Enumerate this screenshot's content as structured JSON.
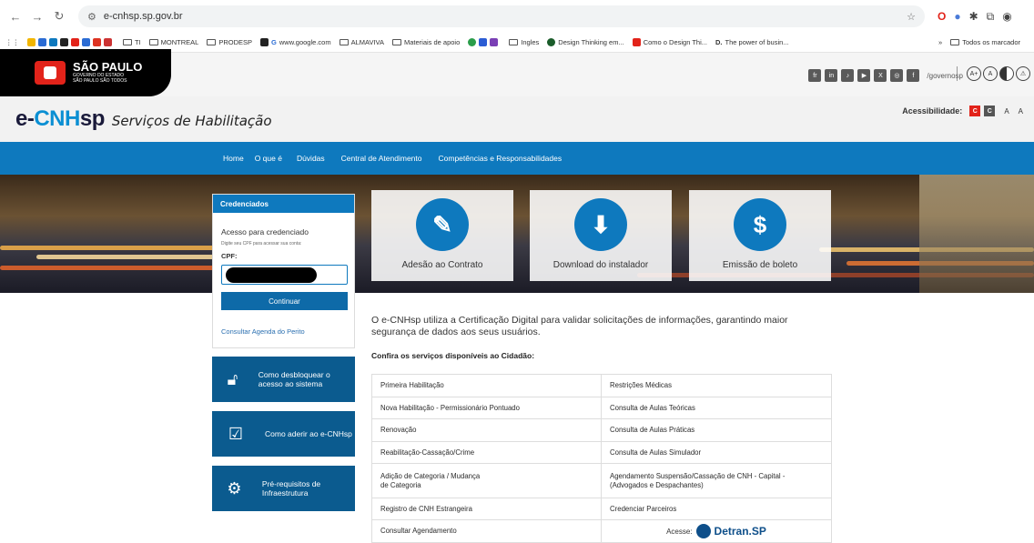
{
  "browser": {
    "url": "e-cnhsp.sp.gov.br",
    "bookmarks": [
      {
        "label": "TI",
        "type": "folder"
      },
      {
        "label": "MONTREAL",
        "type": "folder"
      },
      {
        "label": "PRODESP",
        "type": "folder"
      },
      {
        "label": "www.google.com",
        "type": "site"
      },
      {
        "label": "ALMAVIVA",
        "type": "folder"
      },
      {
        "label": "Materiais de apoio",
        "type": "folder"
      },
      {
        "label": "Ingles",
        "type": "folder"
      },
      {
        "label": "Design Thinking em...",
        "type": "site"
      },
      {
        "label": "Como o Design Thi...",
        "type": "site"
      },
      {
        "label": "The power of busin...",
        "type": "site"
      }
    ],
    "more_bookmarks": "»",
    "all_bookmarks": "Todos os marcador"
  },
  "gov": {
    "logo_title": "SÃO PAULO",
    "logo_sub1": "GOVERNO DO ESTADO",
    "logo_sub2": "SÃO PAULO SÃO TODOS",
    "social_handle": "/governosp"
  },
  "ecnh": {
    "brand_e": "e-",
    "brand_cnh": "CNH",
    "brand_sp": "sp",
    "subtitle": "Serviços de Habilitação",
    "accessibility_label": "Acessibilidade:",
    "contrast1": "C",
    "contrast2": "C",
    "font_minus": "A",
    "font_plus": "A"
  },
  "nav": [
    "Home",
    "O que é",
    "Dúvidas",
    "Central de Atendimento",
    "Competências e Responsabilidades"
  ],
  "cards": [
    {
      "label": "Adesão ao Contrato",
      "icon": "document-edit-icon"
    },
    {
      "label": "Download do instalador",
      "icon": "download-icon"
    },
    {
      "label": "Emissão de boleto",
      "icon": "dollar-icon"
    }
  ],
  "login": {
    "header": "Credenciados",
    "title": "Acesso para credenciado",
    "hint": "Digite seu CPF para acessar sua conta:",
    "cpf_label": "CPF:",
    "button": "Continuar",
    "perito_link": "Consultar Agenda do Perito"
  },
  "side_buttons": [
    {
      "label": "Como desbloquear o acesso ao sistema",
      "icon": "lock-icon"
    },
    {
      "label": "Como aderir ao e-CNHsp",
      "icon": "clipboard-check-icon"
    },
    {
      "label": "Pré-requisitos de Infraestrutura",
      "icon": "gear-icon"
    }
  ],
  "intro": "O e-CNHsp utiliza a Certificação Digital para validar solicitações de informações, garantindo maior segurança de dados aos seus usuários.",
  "services_title": "Confira os serviços disponíveis ao Cidadão:",
  "services_left": [
    "Primeira Habilitação",
    "Nova Habilitação - Permissionário Pontuado",
    "Renovação",
    "Reabilitação-Cassação/Crime",
    "Adição de Categoria / Mudança de Categoria",
    "Registro de CNH Estrangeira",
    "Consultar Agendamento"
  ],
  "services_right": [
    "Restrições Médicas",
    "Consulta de Aulas Teóricas",
    "Consulta de Aulas Práticas",
    "Consulta de Aulas Simulador",
    "Agendamento Suspensão/Cassação de CNH - Capital - (Advogados e Despachantes)",
    "Credenciar Parceiros"
  ],
  "detran": {
    "prefix": "Acesse:",
    "name": "Detran.SP"
  },
  "colors": {
    "primary": "#0e79be",
    "dark": "#0b5b8f",
    "brand_red": "#e2231a"
  }
}
